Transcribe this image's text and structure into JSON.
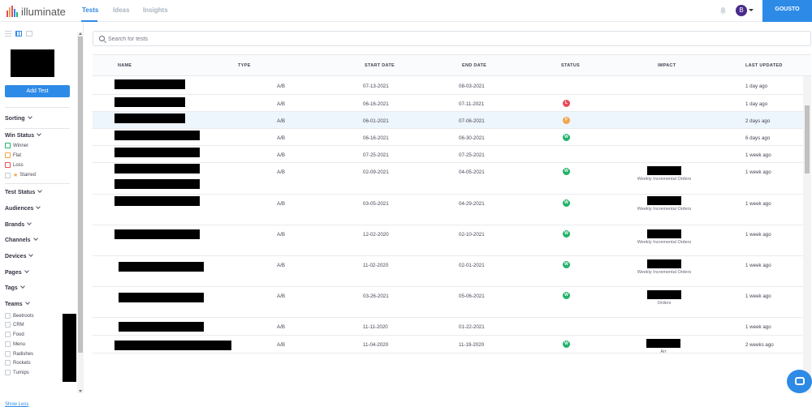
{
  "app": {
    "name": "illuminate",
    "org": "GOUSTO",
    "avatar_initial": "B"
  },
  "nav": {
    "tabs": [
      {
        "label": "Tests"
      },
      {
        "label": "Ideas"
      },
      {
        "label": "Insights"
      }
    ]
  },
  "sidebar": {
    "add_test_label": "Add Test",
    "sorting": "Sorting",
    "win_status": "Win Status",
    "win_options": [
      "Winner",
      "Flat",
      "Loss",
      "Starred"
    ],
    "filters": [
      "Test Status",
      "Audiences",
      "Brands",
      "Channels",
      "Devices",
      "Pages",
      "Tags",
      "Teams"
    ],
    "teams": [
      "Beetroots",
      "CRM",
      "Food",
      "Menu",
      "Radishes",
      "Rockets",
      "Turnips"
    ],
    "show_less": "Show Less"
  },
  "search": {
    "placeholder": "Search for tests",
    "value": ""
  },
  "table": {
    "headers": {
      "name": "NAME",
      "type": "TYPE",
      "start": "START DATE",
      "end": "END DATE",
      "status": "STATUS",
      "impact": "IMPACT",
      "updated": "LAST UPDATED"
    },
    "rows": [
      {
        "type": "A/B",
        "start": "07-13-2021",
        "end": "08-03-2021",
        "status": "",
        "impact": "",
        "updated": "1 day ago"
      },
      {
        "type": "A/B",
        "start": "06-16-2021",
        "end": "07-11-2021",
        "status": "L",
        "impact": "",
        "updated": "1 day ago"
      },
      {
        "type": "A/B",
        "start": "06-01-2021",
        "end": "07-06-2021",
        "status": "F",
        "impact": "",
        "updated": "2 days ago"
      },
      {
        "type": "A/B",
        "start": "06-16-2021",
        "end": "06-30-2021",
        "status": "W",
        "impact": "",
        "updated": "6 days ago"
      },
      {
        "type": "A/B",
        "start": "07-25-2021",
        "end": "07-25-2021",
        "status": "",
        "impact": "",
        "updated": "1 week ago"
      },
      {
        "type": "A/B",
        "start": "02-09-2021",
        "end": "04-05-2021",
        "status": "W",
        "impact": "Weekly Incremental Orders",
        "updated": "1 week ago"
      },
      {
        "type": "A/B",
        "start": "03-05-2021",
        "end": "04-29-2021",
        "status": "W",
        "impact": "Weekly Incremental Orders",
        "updated": "1 week ago"
      },
      {
        "type": "A/B",
        "start": "12-02-2020",
        "end": "02-10-2021",
        "status": "W",
        "impact": "Weekly Incremental Orders",
        "updated": "1 week ago"
      },
      {
        "type": "A/B",
        "start": "11-02-2020",
        "end": "02-01-2021",
        "status": "W",
        "impact": "Weekly Incremental Orders",
        "updated": "1 week ago"
      },
      {
        "type": "A/B",
        "start": "03-26-2021",
        "end": "05-06-2021",
        "status": "W",
        "impact": "Orders",
        "updated": "1 week ago"
      },
      {
        "type": "A/B",
        "start": "11-11-2020",
        "end": "01-22-2021",
        "status": "",
        "impact": "",
        "updated": "1 week ago"
      },
      {
        "type": "A/B",
        "start": "11-04-2020",
        "end": "11-19-2020",
        "status": "W",
        "impact": "Arr",
        "updated": "2 weeks ago"
      }
    ]
  },
  "colors": {
    "accent": "#2d8ae6",
    "win": "#21b36a",
    "loss": "#e74c5a",
    "flat": "#f2a54a",
    "highlight": "#edf5fd"
  }
}
